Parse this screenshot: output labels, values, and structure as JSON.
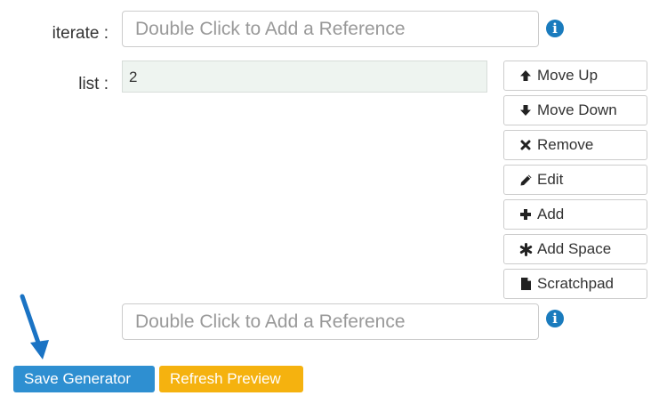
{
  "iterate": {
    "label": "iterate :",
    "placeholder": "Double Click to Add a Reference",
    "info_icon": "info-circle-icon"
  },
  "list": {
    "label": "list :",
    "value": "2"
  },
  "list_buttons": {
    "move_up": {
      "label": "Move Up",
      "icon": "arrow-up-icon"
    },
    "move_down": {
      "label": "Move Down",
      "icon": "arrow-down-icon"
    },
    "remove": {
      "label": "Remove",
      "icon": "x-icon"
    },
    "edit": {
      "label": "Edit",
      "icon": "pencil-icon"
    },
    "add": {
      "label": "Add",
      "icon": "plus-icon"
    },
    "add_space": {
      "label": "Add Space",
      "icon": "asterisk-icon"
    },
    "scratchpad": {
      "label": "Scratchpad",
      "icon": "file-icon"
    }
  },
  "bottom_reference": {
    "placeholder": "Double Click to Add a Reference",
    "info_icon": "info-circle-icon"
  },
  "footer": {
    "save_label": "Save Generator",
    "refresh_label": "Refresh Preview"
  },
  "colors": {
    "save_button": "#2e8fd1",
    "refresh_button": "#f5b20f",
    "info_icon": "#1a7bbd",
    "annotation_arrow": "#1a73c4",
    "list_box_bg": "#eef4f0"
  }
}
